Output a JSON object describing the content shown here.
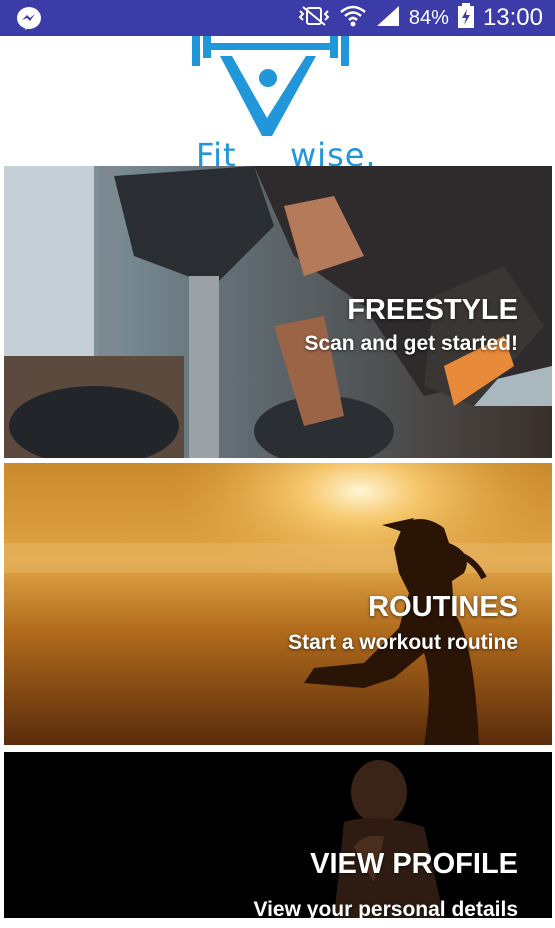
{
  "status_bar": {
    "battery": "84%",
    "time": "13:00",
    "icons": [
      "messenger-icon",
      "vibrate-icon",
      "wifi-icon",
      "signal-icon",
      "battery-charging-icon"
    ]
  },
  "logo": {
    "left": "Fit",
    "right": "wise."
  },
  "cards": [
    {
      "title": "FREESTYLE",
      "subtitle": "Scan and get started!"
    },
    {
      "title": "ROUTINES",
      "subtitle": "Start a workout routine"
    },
    {
      "title": "VIEW PROFILE",
      "subtitle": "View your personal details"
    }
  ],
  "colors": {
    "status_bar": "#3b3ca8",
    "brand": "#2196d8"
  }
}
